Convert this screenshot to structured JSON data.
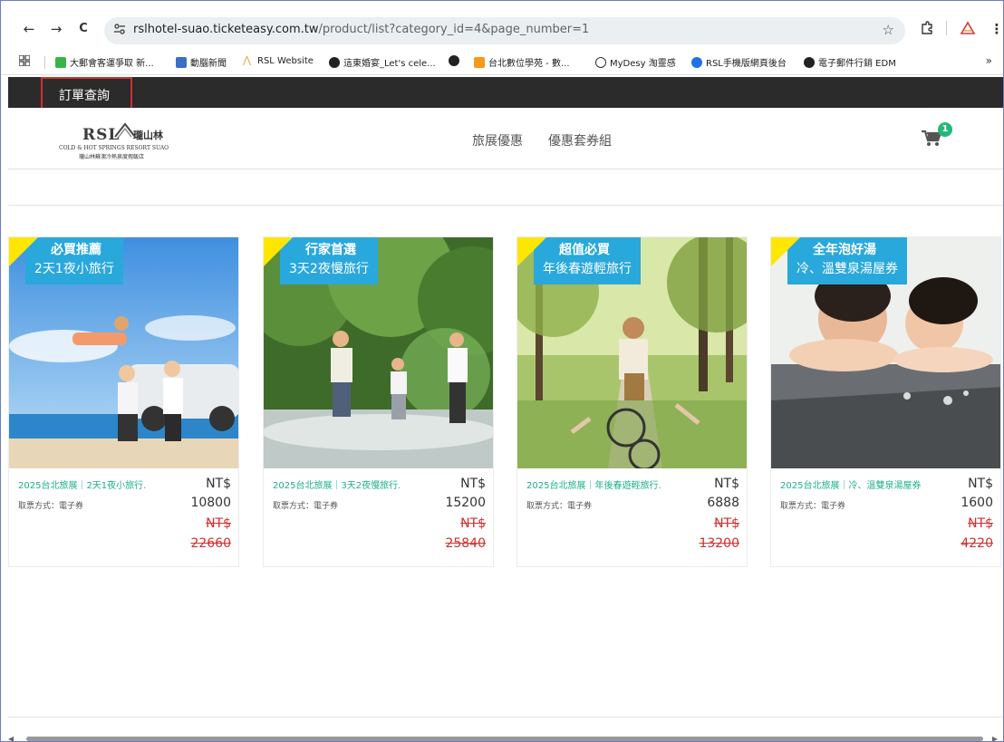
{
  "browser": {
    "url_host": "rslhotel-suao.ticketeasy.com.tw",
    "url_path": "/product/list?category_id=4&page_number=1",
    "back_glyph": "←",
    "forward_glyph": "→",
    "reload_glyph": "C",
    "star_glyph": "☆",
    "more_glyph": "⋮"
  },
  "bookmarks": [
    {
      "label": "大郵會客運爭取 新...",
      "color": "#3bb34a"
    },
    {
      "label": "動腦新聞",
      "color": "#3a6fc4"
    },
    {
      "label": "RSL Website",
      "color": "#e8a23a"
    },
    {
      "label": "這東婚宴_Let's cele...",
      "color": "#222222"
    },
    {
      "label": "",
      "color": "#222222"
    },
    {
      "label": "台北數位學苑 - 數...",
      "color": "#f59a1b"
    },
    {
      "label": "MyDesy 淘靈感",
      "color": "#333333"
    },
    {
      "label": "RSL手機版網頁後台",
      "color": "#1a73e8"
    },
    {
      "label": "電子郵件行銷 EDM",
      "color": "#222222"
    }
  ],
  "bookmarks_more": "»",
  "site": {
    "order_query": "訂單查詢",
    "logo_main": "RSL",
    "logo_cn": "瓏山林",
    "logo_sub1": "COLD & HOT SPRINGS RESORT SUAO",
    "logo_sub2": "瓏山林蘇澳冷熱泉度假飯店",
    "nav": [
      "旅展優惠",
      "優惠套券組"
    ],
    "cart_count": "1"
  },
  "colors": {
    "accent_green": "#1bb08a",
    "tag_blue": "#29a8dc",
    "tag_yellow": "#ffe600",
    "strike_red": "#d32f2f"
  },
  "products": [
    {
      "tag_title": "必買推薦",
      "tag_sub": "2天1夜小旅行",
      "name": "2025台北旅展｜2天1夜小旅行.",
      "ticket": "取票方式：電子券",
      "currency": "NT$",
      "price": "10800",
      "orig_currency": "NT$",
      "orig_price": "22660"
    },
    {
      "tag_title": "行家首選",
      "tag_sub": "3天2夜慢旅行",
      "name": "2025台北旅展｜3天2夜慢旅行.",
      "ticket": "取票方式：電子券",
      "currency": "NT$",
      "price": "15200",
      "orig_currency": "NT$",
      "orig_price": "25840"
    },
    {
      "tag_title": "超值必買",
      "tag_sub": "年後春遊輕旅行",
      "name": "2025台北旅展｜年後春遊輕旅行.",
      "ticket": "取票方式：電子券",
      "currency": "NT$",
      "price": "6888",
      "orig_currency": "NT$",
      "orig_price": "13200"
    },
    {
      "tag_title": "全年泡好湯",
      "tag_sub": "冷、溫雙泉湯屋券",
      "name": "2025台北旅展｜冷、溫雙泉湯屋券",
      "ticket": "取票方式：電子券",
      "currency": "NT$",
      "price": "1600",
      "orig_currency": "NT$",
      "orig_price": "4220"
    }
  ]
}
